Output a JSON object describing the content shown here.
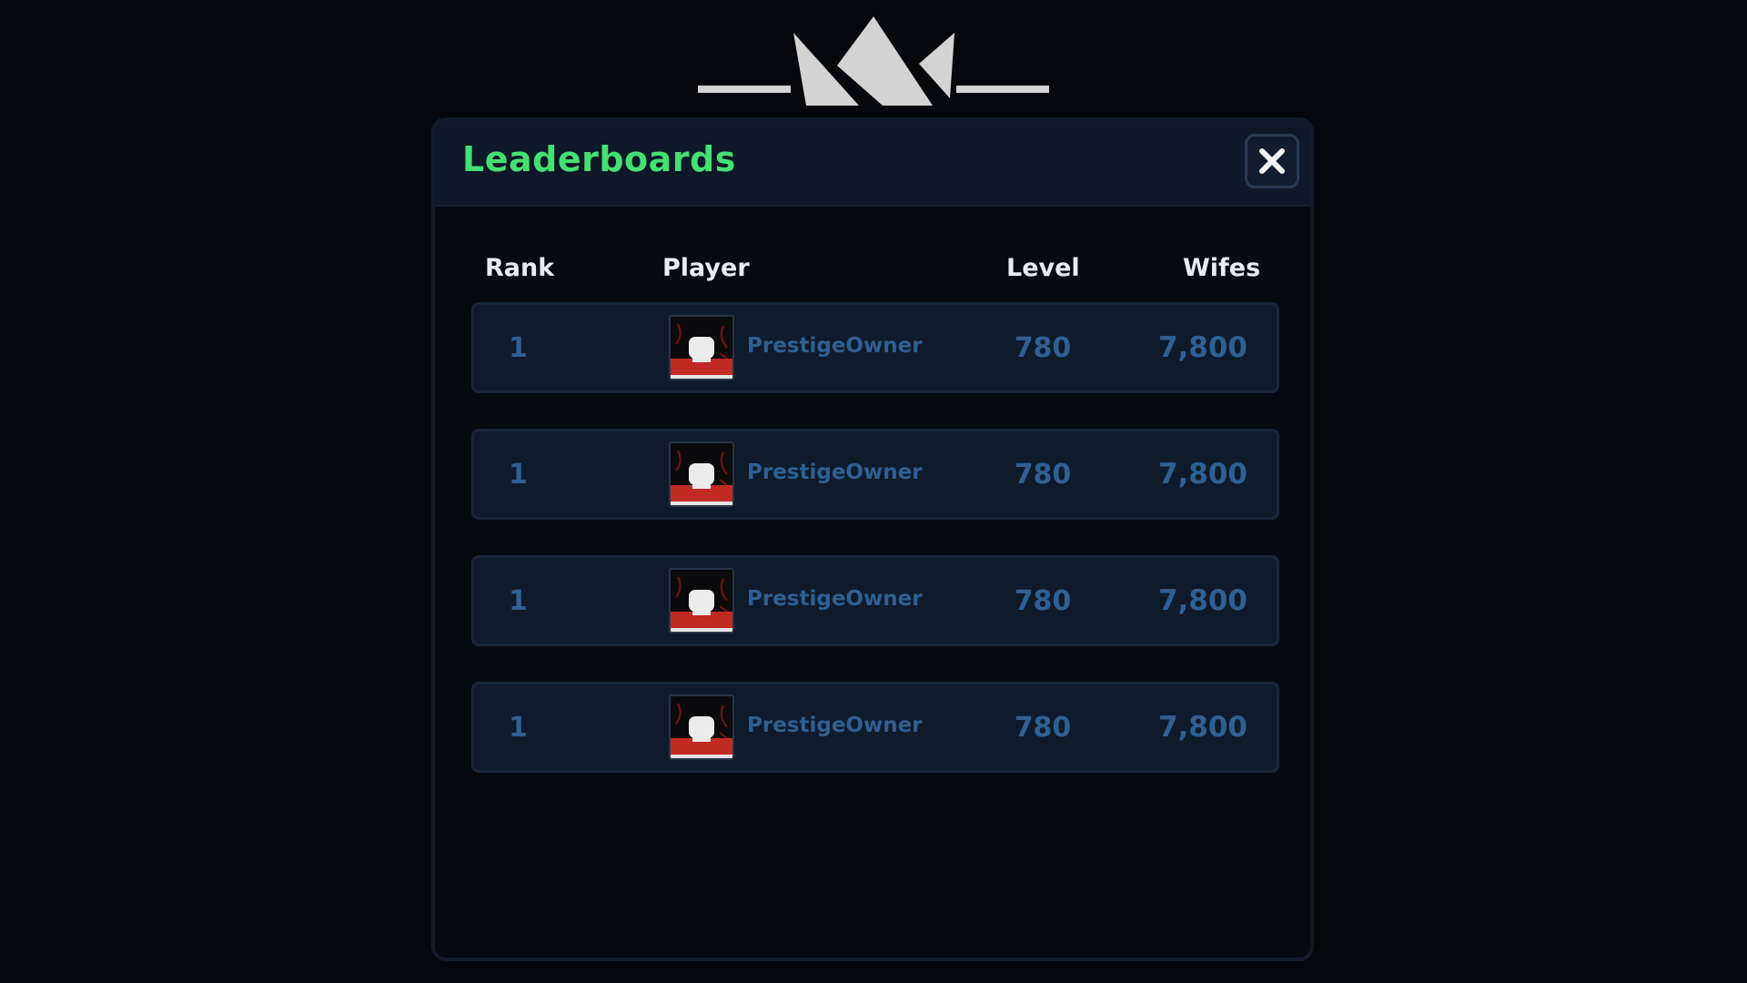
{
  "window": {
    "title": "Leaderboards",
    "close_icon": "close-x-icon",
    "crown_icon": "crown-icon"
  },
  "columns": {
    "rank": "Rank",
    "player": "Player",
    "level": "Level",
    "score": "Wifes"
  },
  "rows": [
    {
      "rank": "1",
      "player": "PrestigeOwner",
      "level": "780",
      "score": "7,800",
      "avatar_icon": "player-avatar-icon"
    },
    {
      "rank": "1",
      "player": "PrestigeOwner",
      "level": "780",
      "score": "7,800",
      "avatar_icon": "player-avatar-icon"
    },
    {
      "rank": "1",
      "player": "PrestigeOwner",
      "level": "780",
      "score": "7,800",
      "avatar_icon": "player-avatar-icon"
    },
    {
      "rank": "1",
      "player": "PrestigeOwner",
      "level": "780",
      "score": "7,800",
      "avatar_icon": "player-avatar-icon"
    }
  ],
  "colors": {
    "title": "#45e072",
    "row_text": "#2f6094",
    "header_text": "#e8ecf2",
    "panel": "#0e1828"
  }
}
